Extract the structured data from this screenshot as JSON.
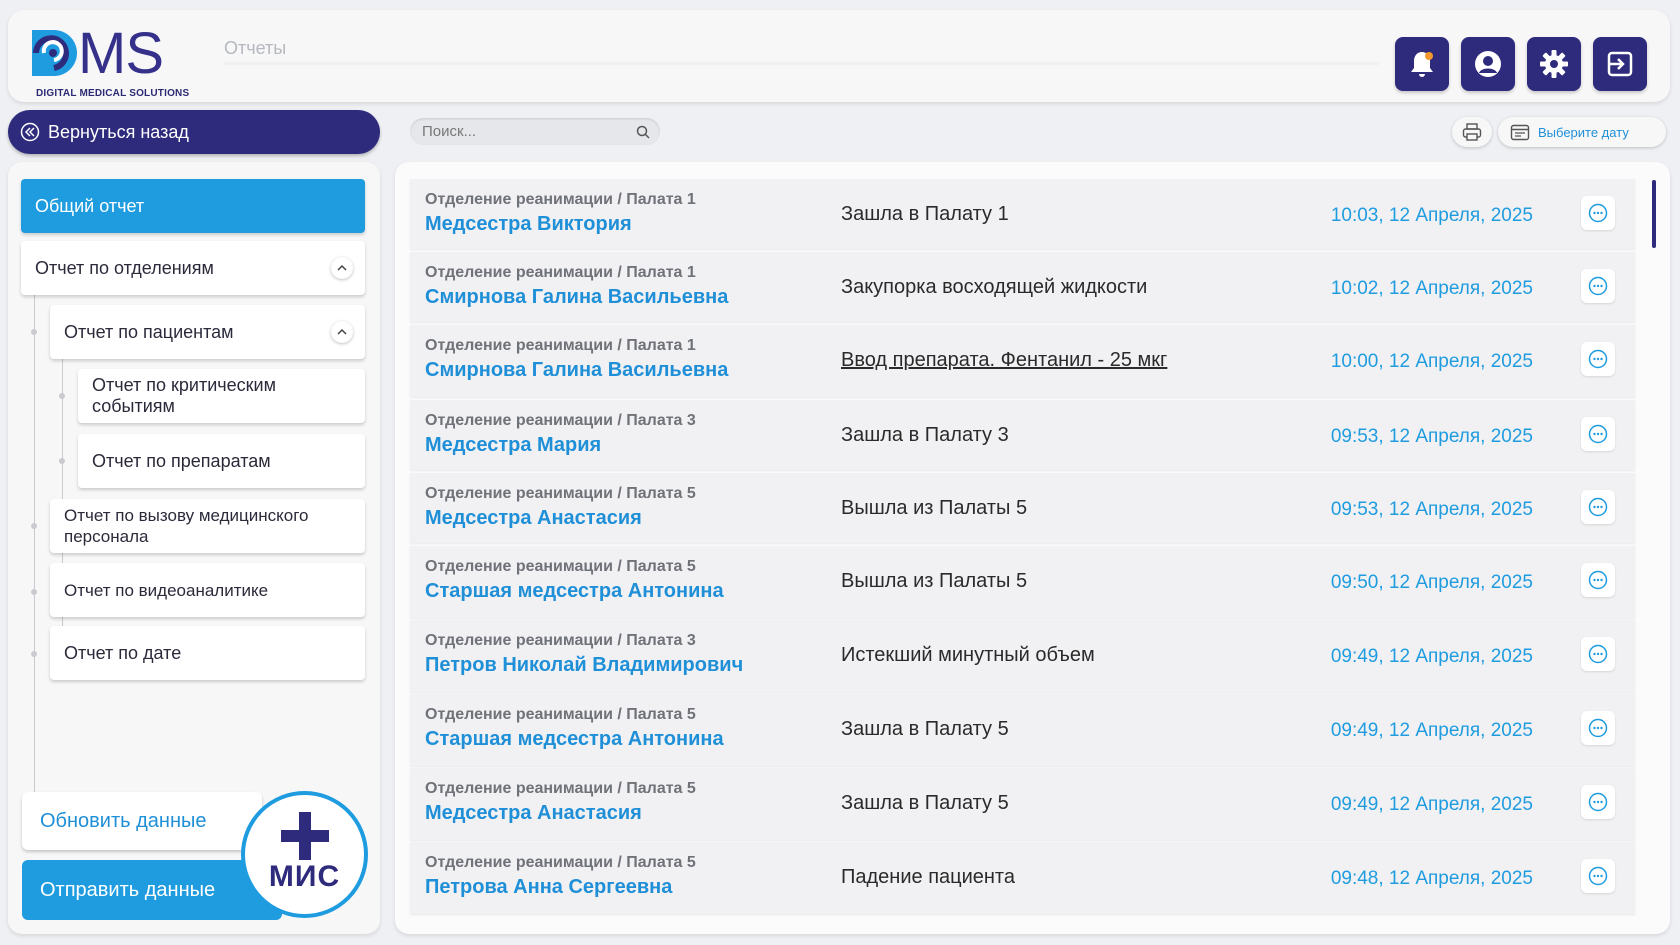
{
  "header": {
    "logo_text": "MS",
    "logo_subtitle": "DIGITAL MEDICAL SOLUTIONS",
    "page_title": "Отчеты"
  },
  "toolbar": {
    "back_label": "Вернуться назад",
    "search_placeholder": "Поиск...",
    "date_label": "Выберите дату"
  },
  "sidebar": {
    "items": [
      {
        "label": "Общий отчет"
      },
      {
        "label": "Отчет по отделениям"
      },
      {
        "label": "Отчет по пациентам"
      },
      {
        "label": "Отчет по критическим событиям"
      },
      {
        "label": "Отчет по препаратам"
      },
      {
        "label": "Отчет по вызову медицинского персонала"
      },
      {
        "label": "Отчет по видеоаналитике"
      },
      {
        "label": "Отчет по дате"
      }
    ],
    "refresh_label": "Обновить данные",
    "send_label": "Отправить данные",
    "mis_label": "МИС"
  },
  "events": [
    {
      "location": "Отделение реанимации / Палата 1",
      "person": "Медсестра Виктория",
      "event": "Зашла в Палату 1",
      "time": "10:03, 12 Апреля, 2025"
    },
    {
      "location": "Отделение реанимации / Палата 1",
      "person": "Смирнова Галина Васильевна",
      "event": "Закупорка восходящей жидкости",
      "time": "10:02, 12 Апреля, 2025"
    },
    {
      "location": "Отделение реанимации / Палата 1",
      "person": "Смирнова Галина Васильевна",
      "event": "Ввод препарата. Фентанил - 25 мкг",
      "time": "10:00, 12 Апреля, 2025"
    },
    {
      "location": "Отделение реанимации / Палата 3",
      "person": "Медсестра Мария",
      "event": "Зашла в Палату 3",
      "time": "09:53, 12 Апреля, 2025"
    },
    {
      "location": "Отделение реанимации / Палата 5",
      "person": "Медсестра Анастасия",
      "event": "Вышла из Палаты 5",
      "time": "09:53, 12 Апреля, 2025"
    },
    {
      "location": "Отделение реанимации / Палата 5",
      "person": "Старшая медсестра Антонина",
      "event": "Вышла из Палаты 5",
      "time": "09:50, 12 Апреля, 2025"
    },
    {
      "location": "Отделение реанимации / Палата 3",
      "person": "Петров Николай Владимирович",
      "event": "Истекший минутный объем",
      "time": "09:49, 12 Апреля, 2025"
    },
    {
      "location": "Отделение реанимации / Палата 5",
      "person": "Старшая медсестра Антонина",
      "event": "Зашла в Палату 5",
      "time": "09:49, 12 Апреля, 2025"
    },
    {
      "location": "Отделение реанимации / Палата 5",
      "person": "Медсестра Анастасия",
      "event": "Зашла в Палату 5",
      "time": "09:49, 12 Апреля, 2025"
    },
    {
      "location": "Отделение реанимации / Палата 5",
      "person": "Петрова Анна Сергеевна",
      "event": "Падение пациента",
      "time": "09:48, 12 Апреля, 2025"
    }
  ],
  "colors": {
    "brand_dark": "#2e2a7c",
    "accent_blue": "#1f9ce0",
    "notification_dot": "#f39a2e"
  },
  "icons": {
    "header": [
      "bell-icon",
      "user-icon",
      "gear-icon",
      "logout-icon"
    ],
    "toolbar": [
      "back-arrow-icon",
      "search-icon",
      "printer-icon",
      "calendar-icon"
    ],
    "row_action": "more-icon"
  }
}
